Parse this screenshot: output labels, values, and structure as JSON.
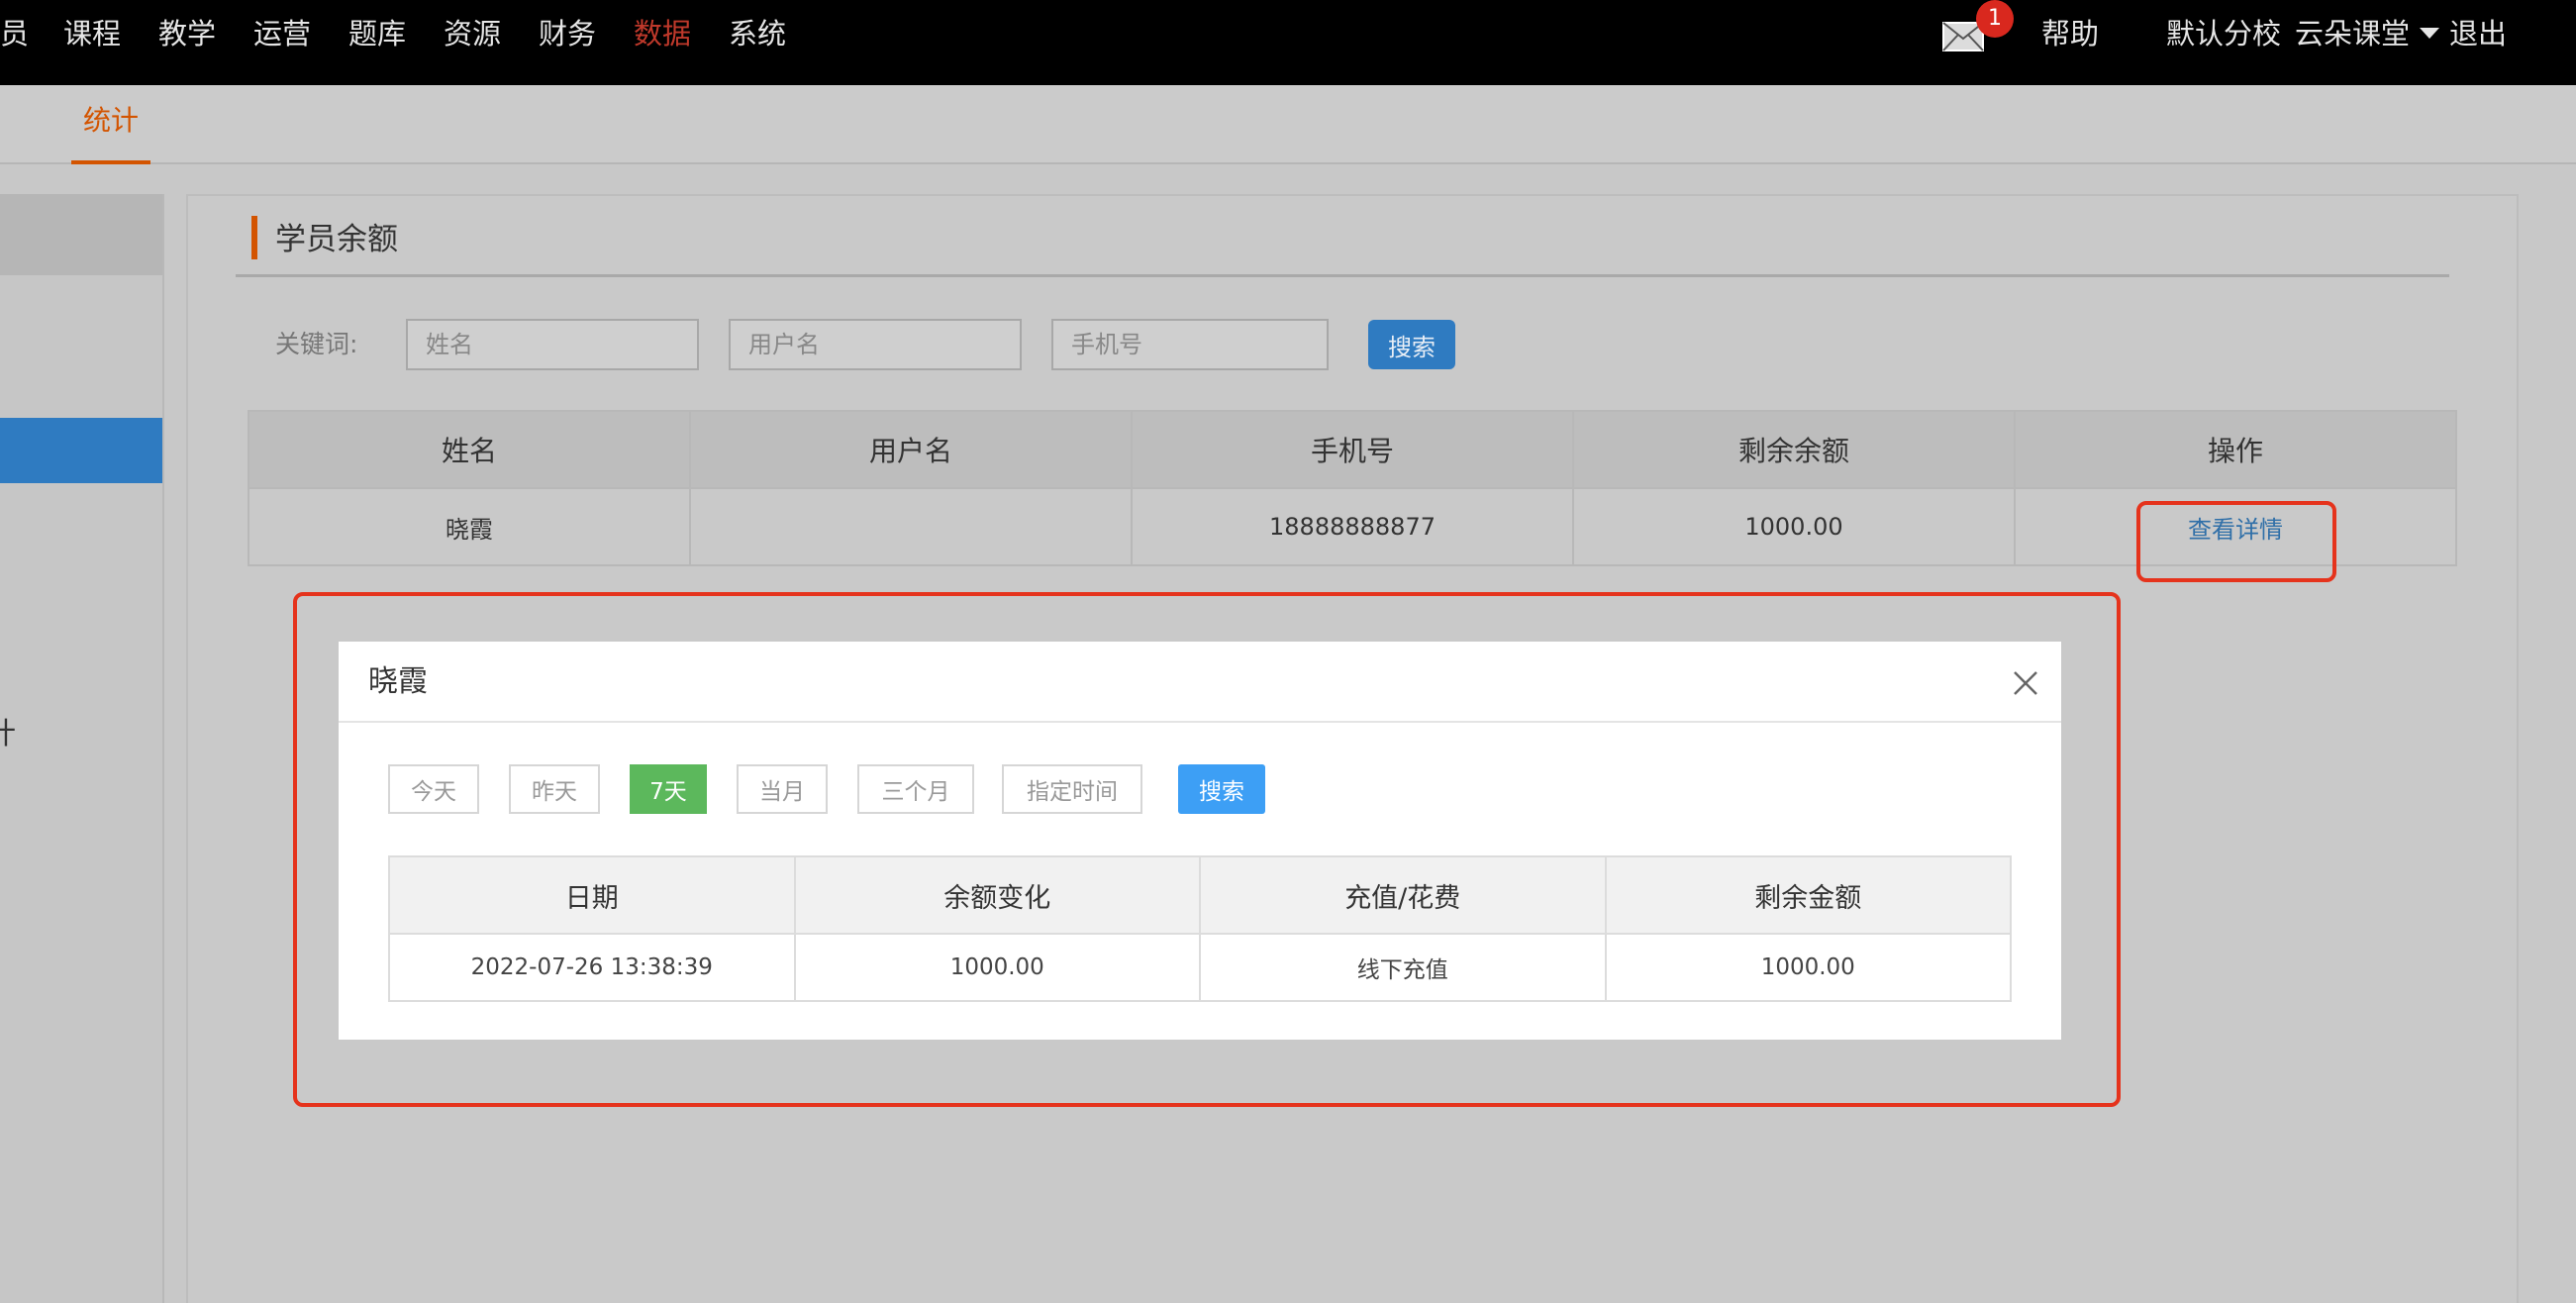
{
  "topnav": {
    "items": [
      {
        "label": "员",
        "active": false
      },
      {
        "label": "课程",
        "active": false
      },
      {
        "label": "教学",
        "active": false
      },
      {
        "label": "运营",
        "active": false
      },
      {
        "label": "题库",
        "active": false
      },
      {
        "label": "资源",
        "active": false
      },
      {
        "label": "财务",
        "active": false
      },
      {
        "label": "数据",
        "active": true
      },
      {
        "label": "系统",
        "active": false
      }
    ],
    "mail_badge": "1",
    "help": "帮助",
    "school": "默认分校",
    "user": "云朵课堂",
    "logout": "退出"
  },
  "subnav": {
    "tab": "统计"
  },
  "sidebar": {
    "fragment": "计"
  },
  "main": {
    "title": "学员余额",
    "search": {
      "label": "关键词:",
      "name_placeholder": "姓名",
      "username_placeholder": "用户名",
      "phone_placeholder": "手机号",
      "button": "搜索"
    },
    "table": {
      "headers": [
        "姓名",
        "用户名",
        "手机号",
        "剩余余额",
        "操作"
      ],
      "row": {
        "name": "晓霞",
        "username": "",
        "phone": "18888888877",
        "balance": "1000.00",
        "action": "查看详情"
      }
    }
  },
  "modal": {
    "title": "晓霞",
    "filters": [
      {
        "label": "今天",
        "active": false
      },
      {
        "label": "昨天",
        "active": false
      },
      {
        "label": "7天",
        "active": true
      },
      {
        "label": "当月",
        "active": false
      },
      {
        "label": "三个月",
        "active": false
      },
      {
        "label": "指定时间",
        "active": false
      }
    ],
    "search_button": "搜索",
    "table": {
      "headers": [
        "日期",
        "余额变化",
        "充值/花费",
        "剩余金额"
      ],
      "row": {
        "date": "2022-07-26 13:38:39",
        "change": "1000.00",
        "type": "线下充值",
        "remaining": "1000.00"
      }
    }
  },
  "colors": {
    "active_nav": "#c0392b",
    "accent_orange": "#d35400",
    "primary_blue": "#2f7bc1",
    "active_filter_green": "#5cb85c",
    "annotation_red": "#e5331c"
  }
}
